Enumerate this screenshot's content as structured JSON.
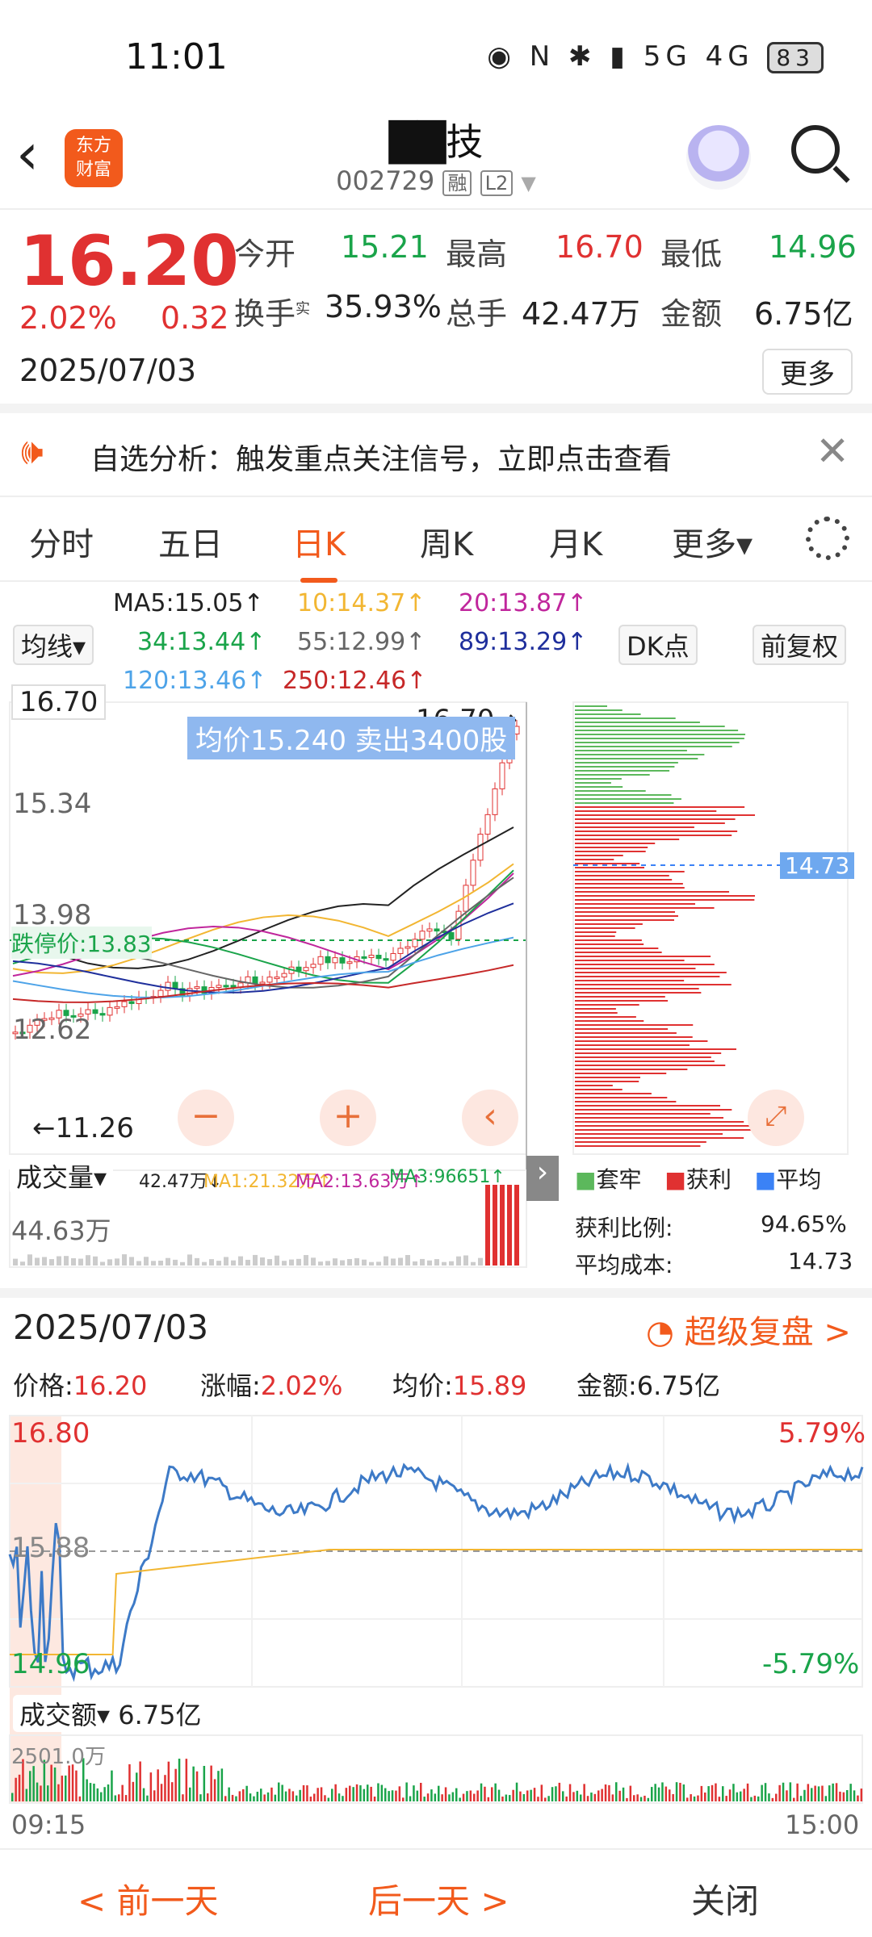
{
  "status": {
    "time": "11:01",
    "icons": "◉ N ✱ ▮ 5G 4G",
    "battery": "83"
  },
  "header": {
    "stock_name": "██技",
    "code": "002729",
    "tag1": "融",
    "tag2": "L2",
    "logo_text": "东方\n财富"
  },
  "quote": {
    "price": "16.20",
    "pct": "2.02%",
    "chg": "0.32",
    "date": "2025/07/03",
    "open_label": "今开",
    "open": "15.21",
    "high_label": "最高",
    "high": "16.70",
    "low_label": "最低",
    "low": "14.96",
    "turnover_label": "换手",
    "turnover_sup": "实",
    "turnover": "35.93%",
    "vol_label": "总手",
    "vol": "42.47万",
    "amt_label": "金额",
    "amt": "6.75亿",
    "more": "更多"
  },
  "notice": {
    "text": "自选分析：触发重点关注信号，立即点击查看",
    "close": "✕"
  },
  "tabs": [
    "分时",
    "五日",
    "日K",
    "周K",
    "月K",
    "更多▾"
  ],
  "kline": {
    "ma_btn": "均线▾",
    "ma": [
      {
        "t": "MA5:15.05↑",
        "c": "#222"
      },
      {
        "t": "10:14.37↑",
        "c": "#f2b632"
      },
      {
        "t": "20:13.87↑",
        "c": "#c0269c"
      },
      {
        "t": "34:13.44↑",
        "c": "#1aa44a"
      },
      {
        "t": "55:12.99↑",
        "c": "#666"
      },
      {
        "t": "89:13.29↑",
        "c": "#1f2f9c"
      },
      {
        "t": "120:13.46↑",
        "c": "#4da3e8"
      },
      {
        "t": "250:12.46↑",
        "c": "#c62828"
      }
    ],
    "dk_btn": "DK点",
    "fq_btn": "前复权",
    "max_label": "16.70",
    "arrow_label": "16.70→",
    "tooltip": "均价15.240  卖出3400股",
    "y1": "15.34",
    "y2": "13.98",
    "limit_down": "跌停价:13.83",
    "y3": "12.62",
    "min_label": "11.26",
    "min_arrow": "←11.26",
    "cost_label": "14.73",
    "vol_btn": "成交量▾",
    "vol_ma": [
      {
        "t": "42.47万↓",
        "c": "#222"
      },
      {
        "t": "MA1:21.32万↑",
        "c": "#f2b632"
      },
      {
        "t": "MA2:13.63万↑",
        "c": "#c0269c"
      },
      {
        "t": "MA3:96651↑",
        "c": "#1aa44a"
      }
    ],
    "vol_max": "44.63万"
  },
  "chip": {
    "legend": [
      "套牢",
      "获利",
      "平均"
    ],
    "profit_label": "获利比例:",
    "profit": "94.65%",
    "cost_label": "平均成本:",
    "cost": "14.73"
  },
  "replay": {
    "date": "2025/07/03",
    "super": "超级复盘 >",
    "price_label": "价格:",
    "price": "16.20",
    "pct_label": "涨幅:",
    "pct": "2.02%",
    "avg_label": "均价:",
    "avg": "15.89",
    "amt_label": "金额:",
    "amt": "6.75亿",
    "hi": "16.80",
    "mid": "15.88",
    "lo": "14.96",
    "hi_pct": "5.79%",
    "lo_pct": "-5.79%",
    "amt_btn": "成交额▾",
    "amt_total": "6.75亿",
    "vol_axis": "2501.0万",
    "t_start": "09:15",
    "t_end": "15:00"
  },
  "footer": {
    "prev": "< 前一天",
    "next": "后一天 >",
    "close": "关闭"
  }
}
